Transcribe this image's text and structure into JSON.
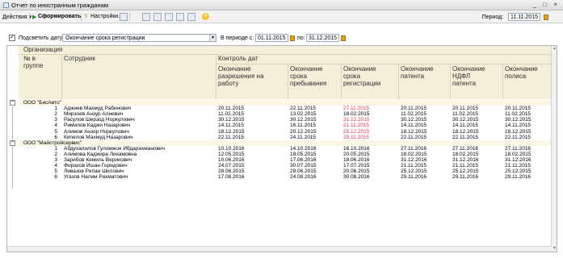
{
  "window": {
    "title": "Отчет по иностранным гражданам",
    "controls": "_ □ ×"
  },
  "toolbar": {
    "actions": "Действия ▾",
    "generate": "Сформировать",
    "settings": "Настройки...",
    "period_label": "Период:",
    "period_value": "11.11.2015"
  },
  "filter": {
    "checked": true,
    "label": "Подсветить дату:",
    "selected": "Окончание срока регистрации",
    "in_period": "В периоде с:",
    "date_from": "01.11.2015",
    "po": "по:",
    "date_to": "31.12.2015"
  },
  "header": {
    "org": "Организация",
    "num": [
      "№ в",
      "группе"
    ],
    "employee": "Сотрудник",
    "control": "Контроль дат",
    "cols": [
      [
        "Окончание",
        "разрешения на",
        "работу"
      ],
      [
        "Окончание",
        "срока",
        "пребывания"
      ],
      [
        "Окончание",
        "срока",
        "регистрации"
      ],
      [
        "Окончание",
        "патента"
      ],
      [
        "Окончание",
        "НДФЛ",
        "патента"
      ],
      [
        "Окончание",
        "полиса"
      ]
    ]
  },
  "groups": [
    {
      "name": "ООО \"БисАвто\"",
      "rows": [
        {
          "n": "1",
          "name": "Аджиев Махмуд Рабинович",
          "d": [
            "20.11.2015",
            "22.11.2015",
            "27.11.2015",
            "20.11.2015",
            "20.11.2015",
            "20.11.2015"
          ],
          "hl": 2
        },
        {
          "n": "2",
          "name": "Мирзоев Анзур Алиевич",
          "d": [
            "11.02.2015",
            "13.02.2015",
            "18.02.2015",
            "11.02.2015",
            "11.02.2015",
            "11.02.2015"
          ],
          "hl": -1
        },
        {
          "n": "3",
          "name": "Расулов Шерзод Норкулович",
          "d": [
            "30.12.2015",
            "30.12.2015",
            "31.12.2015",
            "30.12.2015",
            "30.12.2015",
            "30.12.2015"
          ],
          "hl": 2
        },
        {
          "n": "4",
          "name": "Римилов Каджи Назарович",
          "d": [
            "14.11.2015",
            "16.11.2015",
            "21.11.2015",
            "14.11.2015",
            "14.11.2015",
            "14.11.2015"
          ],
          "hl": 2
        },
        {
          "n": "5",
          "name": "Алимов Анзор Норкулович",
          "d": [
            "18.12.2015",
            "20.12.2015",
            "25.12.2015",
            "18.12.2015",
            "18.12.2015",
            "18.12.2015"
          ],
          "hl": 2
        },
        {
          "n": "6",
          "name": "Кипилов Махмуд Назарович",
          "d": [
            "22.11.2015",
            "24.11.2015",
            "29.11.2015",
            "22.11.2015",
            "22.11.2015",
            "22.11.2015"
          ],
          "hl": 2
        }
      ]
    },
    {
      "name": "ООО \"Майстройсервис\"",
      "rows": [
        {
          "n": "1",
          "name": "Абдухалилов Гуломжон Ибдарахманович",
          "d": [
            "10.10.2016",
            "14.10.2016",
            "16.10.2016",
            "27.11.2016",
            "27.11.2016",
            "27.11.2016"
          ],
          "hl": -1
        },
        {
          "n": "2",
          "name": "Алимова Каджира Лихамовна",
          "d": [
            "12.05.2015",
            "19.05.2015",
            "20.05.2015",
            "18.02.2015",
            "18.02.2015",
            "18.02.2015"
          ],
          "hl": -1
        },
        {
          "n": "3",
          "name": "Зарибов Кемиль Верикович",
          "d": [
            "10.06.2016",
            "17.06.2016",
            "18.06.2016",
            "31.12.2016",
            "31.12.2016",
            "31.12.2016"
          ],
          "hl": -1
        },
        {
          "n": "4",
          "name": "Фирахов Ишан Горидович",
          "d": [
            "24.07.2015",
            "30.07.2015",
            "17.07.2015",
            "21.11.2015",
            "21.11.2015",
            "21.11.2015"
          ],
          "hl": -1
        },
        {
          "n": "5",
          "name": "Ливазов Рипан Шилович",
          "d": [
            "28.06.2015",
            "29.06.2015",
            "20.06.2015",
            "25.12.2015",
            "25.12.2015",
            "25.12.2015"
          ],
          "hl": -1
        },
        {
          "n": "6",
          "name": "Угазов Налим Рахматович",
          "d": [
            "17.08.2016",
            "24.08.2016",
            "30.08.2016",
            "29.11.2016",
            "29.11.2016",
            "29.11.2016"
          ],
          "hl": -1
        }
      ]
    }
  ]
}
